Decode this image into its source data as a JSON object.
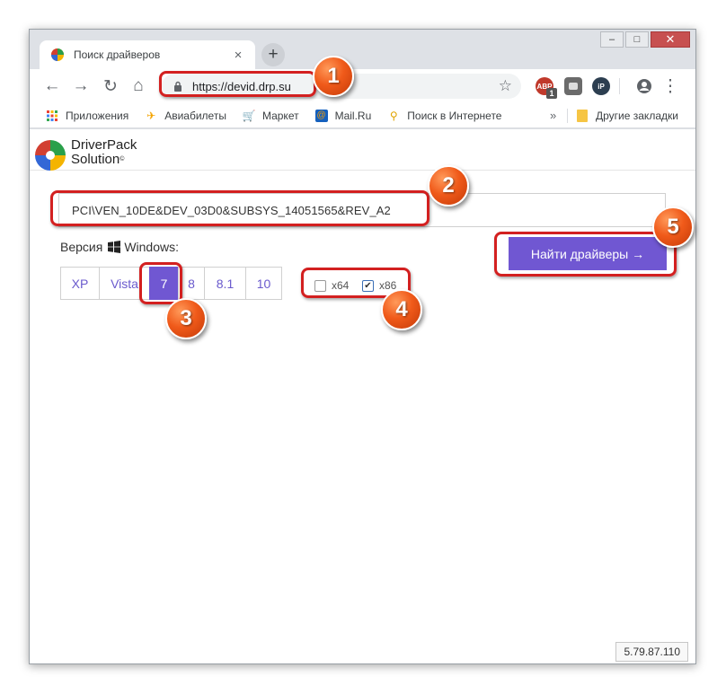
{
  "browser": {
    "tab_title": "Поиск драйверов",
    "tab_close": "×",
    "new_tab": "+",
    "window_controls": {
      "minimize": "–",
      "maximize": "□",
      "close": "✕"
    },
    "url": "https://devid.drp.su",
    "extensions": [
      {
        "name": "adblock-icon",
        "label": "ABP",
        "badge": "1",
        "color": "#c0392b"
      },
      {
        "name": "ghostery-icon",
        "label": "",
        "color": "#6b6b6b"
      },
      {
        "name": "ip-icon",
        "label": "iP",
        "color": "#2c3e50"
      }
    ]
  },
  "bookmarks": {
    "items": [
      {
        "name": "apps",
        "label": "Приложения"
      },
      {
        "name": "avia",
        "label": "Авиабилеты"
      },
      {
        "name": "market",
        "label": "Маркет"
      },
      {
        "name": "mailru",
        "label": "Mail.Ru"
      },
      {
        "name": "search",
        "label": "Поиск в Интернете"
      }
    ],
    "more": "»",
    "other": "Другие закладки"
  },
  "site": {
    "logo_line1": "DriverPack",
    "logo_line2": "Solution",
    "logo_mark": "©",
    "device_id": "PCI\\VEN_10DE&DEV_03D0&SUBSYS_14051565&REV_A2",
    "version_label": "Версия",
    "os_label": "Windows:",
    "versions": [
      "XP",
      "Vista",
      "7",
      "8",
      "8.1",
      "10"
    ],
    "active_version": "7",
    "arch": [
      {
        "label": "x64",
        "checked": false
      },
      {
        "label": "x86",
        "checked": true
      }
    ],
    "find_button": "Найти драйверы →",
    "ip": "5.79.87.110"
  },
  "annotations": [
    "1",
    "2",
    "3",
    "4",
    "5"
  ],
  "colors": {
    "accent": "#7057d2",
    "highlight": "#d32020",
    "badge": "#f05a1a"
  }
}
